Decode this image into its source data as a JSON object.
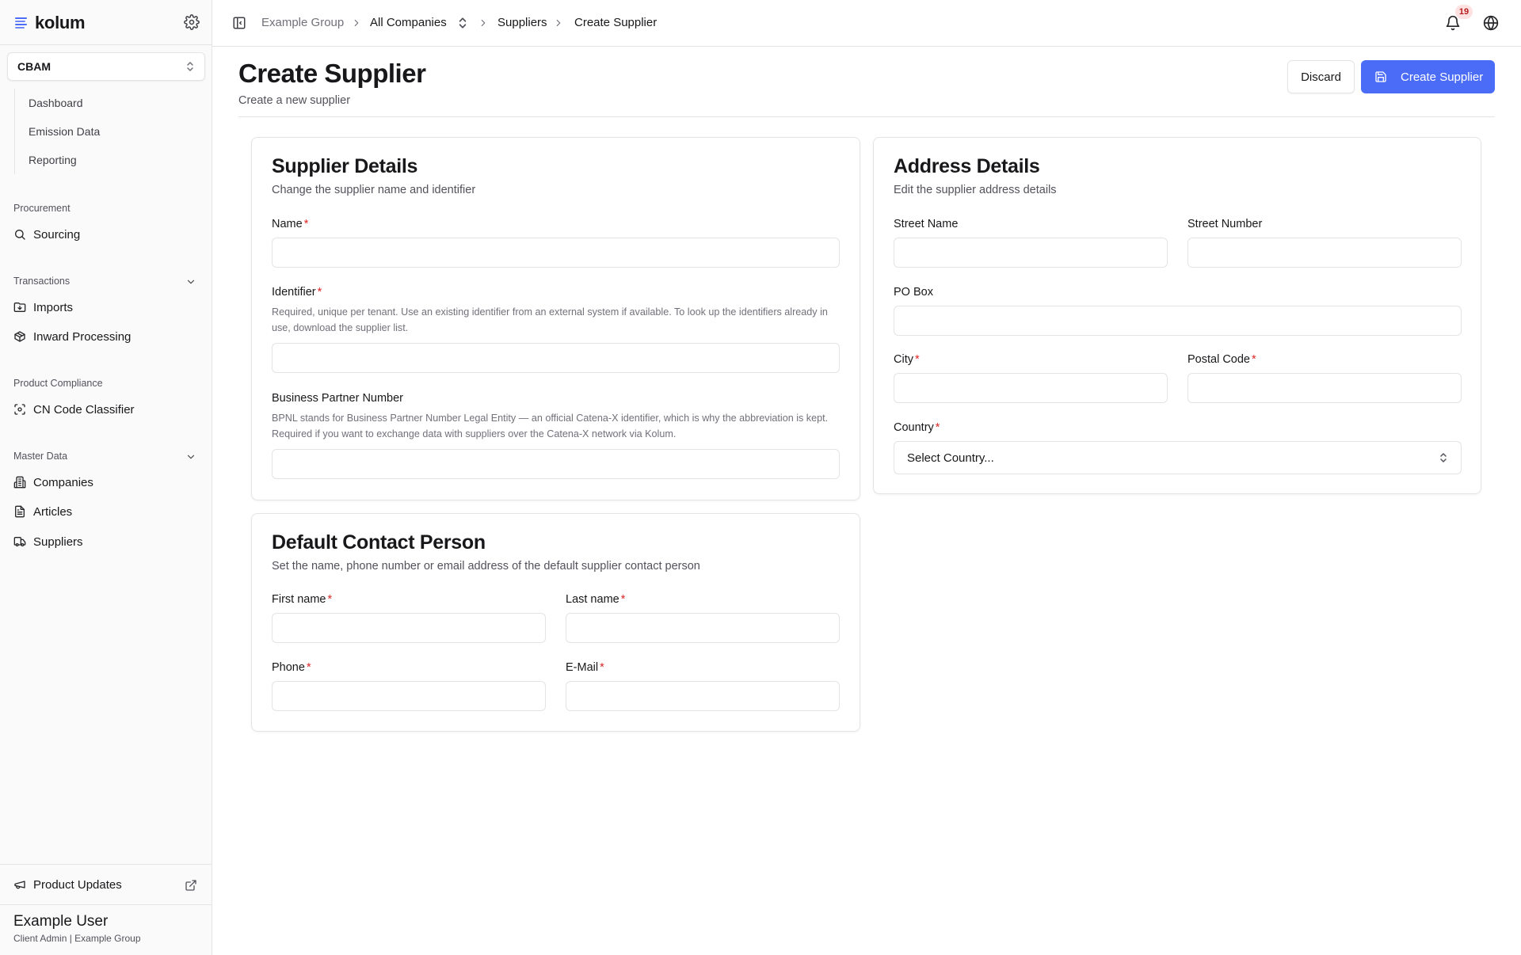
{
  "brand": {
    "name": "kolum"
  },
  "sidebar": {
    "module": "CBAM",
    "module_items": [
      {
        "label": "Dashboard"
      },
      {
        "label": "Emission Data"
      },
      {
        "label": "Reporting"
      }
    ],
    "groups": {
      "procurement": {
        "label": "Procurement",
        "items": [
          {
            "label": "Sourcing",
            "icon": "search-icon"
          }
        ]
      },
      "transactions": {
        "label": "Transactions",
        "items": [
          {
            "label": "Imports",
            "icon": "folder-import-icon"
          },
          {
            "label": "Inward Processing",
            "icon": "package-icon"
          }
        ]
      },
      "product_compliance": {
        "label": "Product Compliance",
        "items": [
          {
            "label": "CN Code Classifier",
            "icon": "scan-icon"
          }
        ]
      },
      "master_data": {
        "label": "Master Data",
        "items": [
          {
            "label": "Companies",
            "icon": "building-icon"
          },
          {
            "label": "Articles",
            "icon": "file-text-icon"
          },
          {
            "label": "Suppliers",
            "icon": "truck-icon"
          }
        ]
      }
    },
    "product_updates": "Product Updates",
    "user": {
      "name": "Example User",
      "role": "Client Admin | Example Group"
    }
  },
  "topbar": {
    "breadcrumb": [
      {
        "label": "Example Group"
      },
      {
        "label": "All Companies"
      },
      {
        "label": "Suppliers"
      },
      {
        "label": "Create Supplier"
      }
    ],
    "notification_count": "19"
  },
  "page": {
    "title": "Create Supplier",
    "subtitle": "Create a new supplier",
    "discard_label": "Discard",
    "create_label": "Create Supplier"
  },
  "supplier_details": {
    "title": "Supplier Details",
    "subtitle": "Change the supplier name and identifier",
    "name_label": "Name",
    "identifier_label": "Identifier",
    "identifier_help": "Required, unique per tenant. Use an existing identifier from an external system if available. To look up the identifiers already in use, download the supplier list.",
    "bpn_label": "Business Partner Number",
    "bpn_help": "BPNL stands for Business Partner Number Legal Entity — an official Catena-X identifier, which is why the abbreviation is kept. Required if you want to exchange data with suppliers over the Catena-X network via Kolum."
  },
  "contact_person": {
    "title": "Default Contact Person",
    "subtitle": "Set the name, phone number or email address of the default supplier contact person",
    "first_name_label": "First name",
    "last_name_label": "Last name",
    "phone_label": "Phone",
    "email_label": "E-Mail"
  },
  "address_details": {
    "title": "Address Details",
    "subtitle": "Edit the supplier address details",
    "street_name_label": "Street Name",
    "street_number_label": "Street Number",
    "po_box_label": "PO Box",
    "city_label": "City",
    "postal_code_label": "Postal Code",
    "country_label": "Country",
    "country_placeholder": "Select Country..."
  },
  "colors": {
    "primary": "#4a6cf7",
    "required": "#dc2626",
    "badge_bg": "#fee2e2",
    "badge_text": "#b91c1c"
  }
}
